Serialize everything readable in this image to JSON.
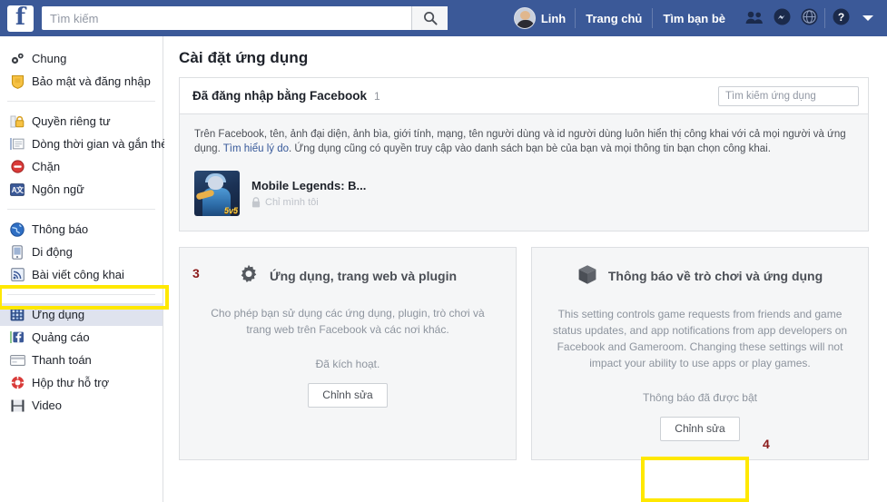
{
  "topbar": {
    "logo": "f",
    "logo_icon": "facebook-logo-icon",
    "search": {
      "value": "",
      "placeholder": "Tìm kiếm",
      "icon": "search-icon"
    },
    "user_name": "Linh",
    "links": [
      {
        "label": "Trang chủ",
        "name": "home-link"
      },
      {
        "label": "Tìm bạn bè",
        "name": "find-friends-link"
      }
    ],
    "icons": [
      {
        "name": "friend-requests-icon",
        "label": "Friend requests"
      },
      {
        "name": "messenger-icon",
        "label": "Messenger"
      },
      {
        "name": "notifications-globe-icon",
        "label": "Notifications"
      },
      {
        "name": "help-icon",
        "label": "Help"
      },
      {
        "name": "account-dropdown-caret-icon",
        "label": "Account"
      }
    ]
  },
  "sidebar": {
    "groups": [
      {
        "items": [
          {
            "label": "Chung",
            "icon": "gears-icon",
            "selected": false
          },
          {
            "label": "Bảo mật và đăng nhập",
            "icon": "shield-icon",
            "selected": false
          }
        ]
      },
      {
        "items": [
          {
            "label": "Quyền riêng tư",
            "icon": "padlock-icon",
            "selected": false
          },
          {
            "label": "Dòng thời gian và gắn thẻ",
            "icon": "timeline-icon",
            "selected": false
          },
          {
            "label": "Chặn",
            "icon": "block-icon",
            "selected": false
          },
          {
            "label": "Ngôn ngữ",
            "icon": "language-icon",
            "selected": false
          }
        ]
      },
      {
        "items": [
          {
            "label": "Thông báo",
            "icon": "globe-icon",
            "selected": false
          },
          {
            "label": "Di động",
            "icon": "mobile-icon",
            "selected": false
          },
          {
            "label": "Bài viết công khai",
            "icon": "rss-icon",
            "selected": false
          }
        ]
      },
      {
        "items": [
          {
            "label": "Ứng dụng",
            "icon": "apps-icon",
            "selected": true
          },
          {
            "label": "Quảng cáo",
            "icon": "ads-icon",
            "selected": false
          },
          {
            "label": "Thanh toán",
            "icon": "payments-icon",
            "selected": false
          },
          {
            "label": "Hộp thư hỗ trợ",
            "icon": "support-lifebuoy-icon",
            "selected": false
          },
          {
            "label": "Video",
            "icon": "video-filmstrip-icon",
            "selected": false
          }
        ]
      }
    ]
  },
  "main": {
    "page_title": "Cài đặt ứng dụng",
    "logged_in_card": {
      "title": "Đã đăng nhập bằng Facebook",
      "count": "1",
      "search": {
        "value": "",
        "placeholder": "Tìm kiếm ứng dụng"
      },
      "info_before_link": "Trên Facebook, tên, ảnh đại diện, ảnh bìa, giới tính, mạng, tên người dùng và id người dùng luôn hiển thị công khai với cả mọi người và ứng dụng. ",
      "info_link": "Tìm hiểu lý do",
      "info_after_link": ". Ứng dụng cũng có quyền truy cập vào danh sách bạn bè của bạn và mọi thông tin bạn chọn công khai.",
      "apps": [
        {
          "name": "Mobile Legends: B...",
          "privacy": "Chỉ mình tôi",
          "privacy_icon": "lock-icon",
          "thumb_badge": "5v5"
        }
      ]
    },
    "panels": [
      {
        "icon": "gear-icon",
        "title": "Ứng dụng, trang web và plugin",
        "description": "Cho phép bạn sử dụng các ứng dụng, plugin, trò chơi và trang web trên Facebook và các nơi khác.",
        "status": "Đã kích hoạt.",
        "button": "Chỉnh sửa"
      },
      {
        "icon": "cube-box-icon",
        "title": "Thông báo về trò chơi và ứng dụng",
        "description": "This setting controls game requests from friends and game status updates, and app notifications from app developers on Facebook and Gameroom. Changing these settings will not impact your ability to use apps or play games.",
        "status": "Thông báo đã được bật",
        "button": "Chỉnh sửa"
      }
    ]
  },
  "annotations": [
    {
      "label": "3",
      "target": "sidebar-item-apps"
    },
    {
      "label": "4",
      "target": "notifications-edit-button"
    }
  ],
  "colors": {
    "header_blue": "#3b5998",
    "highlight_yellow": "#ffe800",
    "annotation_red": "#8b1a1a",
    "link_blue": "#365899",
    "selected_row": "#dfe3ee"
  }
}
